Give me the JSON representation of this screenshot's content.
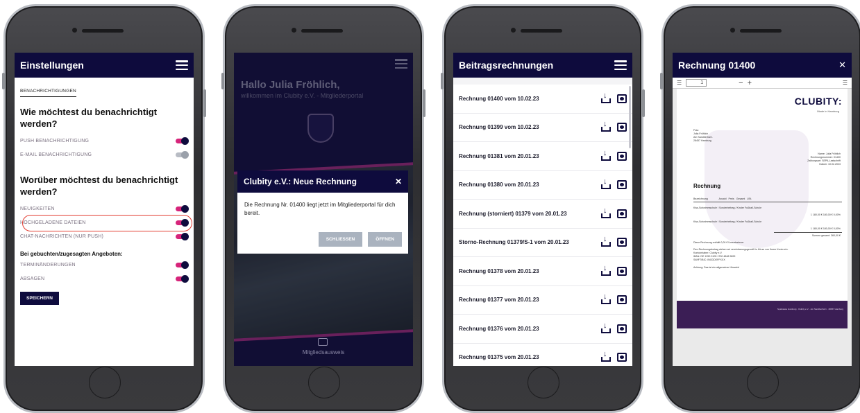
{
  "screen1": {
    "title": "Einstellungen",
    "tab": "BENACHRICHTIGUNGEN",
    "question1": "Wie möchtest du benachrichtigt werden?",
    "toggles1": [
      {
        "label": "PUSH BENACHRICHTIGUNG",
        "on": true
      },
      {
        "label": "E-MAIL BENACHRICHTIGUNG",
        "on": false
      }
    ],
    "question2": "Worüber möchtest du benachrichtigt werden?",
    "toggles2": [
      {
        "label": "NEUIGKEITEN",
        "on": true
      },
      {
        "label": "HOCHGELADENE DATEIEN",
        "on": true
      },
      {
        "label": "CHAT-NACHRICHTEN (NUR PUSH)",
        "on": true
      }
    ],
    "subheading": "Bei gebuchten/zugesagten Angeboten:",
    "toggles3": [
      {
        "label": "TERMINÄNDERUNGEN",
        "on": true
      },
      {
        "label": "ABSAGEN",
        "on": true
      }
    ],
    "save_label": "SPEICHERN"
  },
  "screen2": {
    "greeting": "Hallo Julia Fröhlich,",
    "welcome": "willkommen im Clubity e.V. - Mitgliederportal",
    "modal_title": "Clubity e.V.: Neue Rechnung",
    "modal_text": "Die Rechnung Nr. 01400 liegt jetzt im Mitgliederportal für dich bereit.",
    "close_label": "SCHLIESSEN",
    "open_label": "ÖFFNEN",
    "card_label": "Mitgliedsausweis"
  },
  "screen3": {
    "title": "Beitragsrechnungen",
    "invoices": [
      "Rechnung 01400 vom 10.02.23",
      "Rechnung 01399 vom 10.02.23",
      "Rechnung 01381 vom 20.01.23",
      "Rechnung 01380 vom 20.01.23",
      "Rechnung (storniert) 01379 vom 20.01.23",
      "Storno-Rechnung 01379/S-1 vom 20.01.23",
      "Rechnung 01378 vom 20.01.23",
      "Rechnung 01377 vom 20.01.23",
      "Rechnung 01376 vom 20.01.23",
      "Rechnung 01375 vom 20.01.23"
    ]
  },
  "screen4": {
    "title": "Rechnung 01400",
    "page_number": "1",
    "zoom_minus": "−",
    "zoom_plus": "+",
    "logo": "CLUBITY:",
    "logo_sub": "Made in Hamburg",
    "doc_heading": "Rechnung",
    "recipient": [
      "Frau",
      "Julia Fröhlich",
      "Am Sandberhal 1",
      "28457 Hamburg"
    ],
    "meta": [
      "Name: Julia Fröhlich",
      "Rechnungsnummer: 01400",
      "Zahlungsart: SEPA-Lastschrift",
      "Datum: 10.02.2023"
    ],
    "table_head": "Bezeichnung                Anzahl   Preis   Gesamt   USt.",
    "item1": "Kiss-Schwimmschule / Sonderbeitrag / Kinder Fußball-Schule",
    "item1_vals": "1   180,00 €   180,00 €   0,00%",
    "item2": "Kiss-Schwimmschule / Sonderbeitrag / Kinder Fußball-Schule",
    "item2_vals": "1   180,00 €   180,00 €   0,00%",
    "sum": "Summe gesamt:   360,00 €",
    "tax_note": "Diese Rechnung enthält 0,00 € Umsatzsteuer",
    "sepa": [
      "Den Rechnungsbetrag ziehen wir vereinbarungsgemäß in Kürze von Ihrem Konto ein.",
      "Kontoinhaber: Clubity e.V.",
      "IBAN: DE 1250 0105 1700 4848 9899",
      "SWIFT/BIC: INGDDEFFXXX"
    ],
    "note": "Achtung: Das ist ein allgemeiner Hinweis!",
    "footer": "Sparkasse Hamburg · Clubity e.V. · Am Sandberhal 1 · 28457 Hamburg"
  },
  "colors": {
    "brand": "#0e0b3d",
    "accent": "#d6247a",
    "highlight": "#e23a2f"
  }
}
